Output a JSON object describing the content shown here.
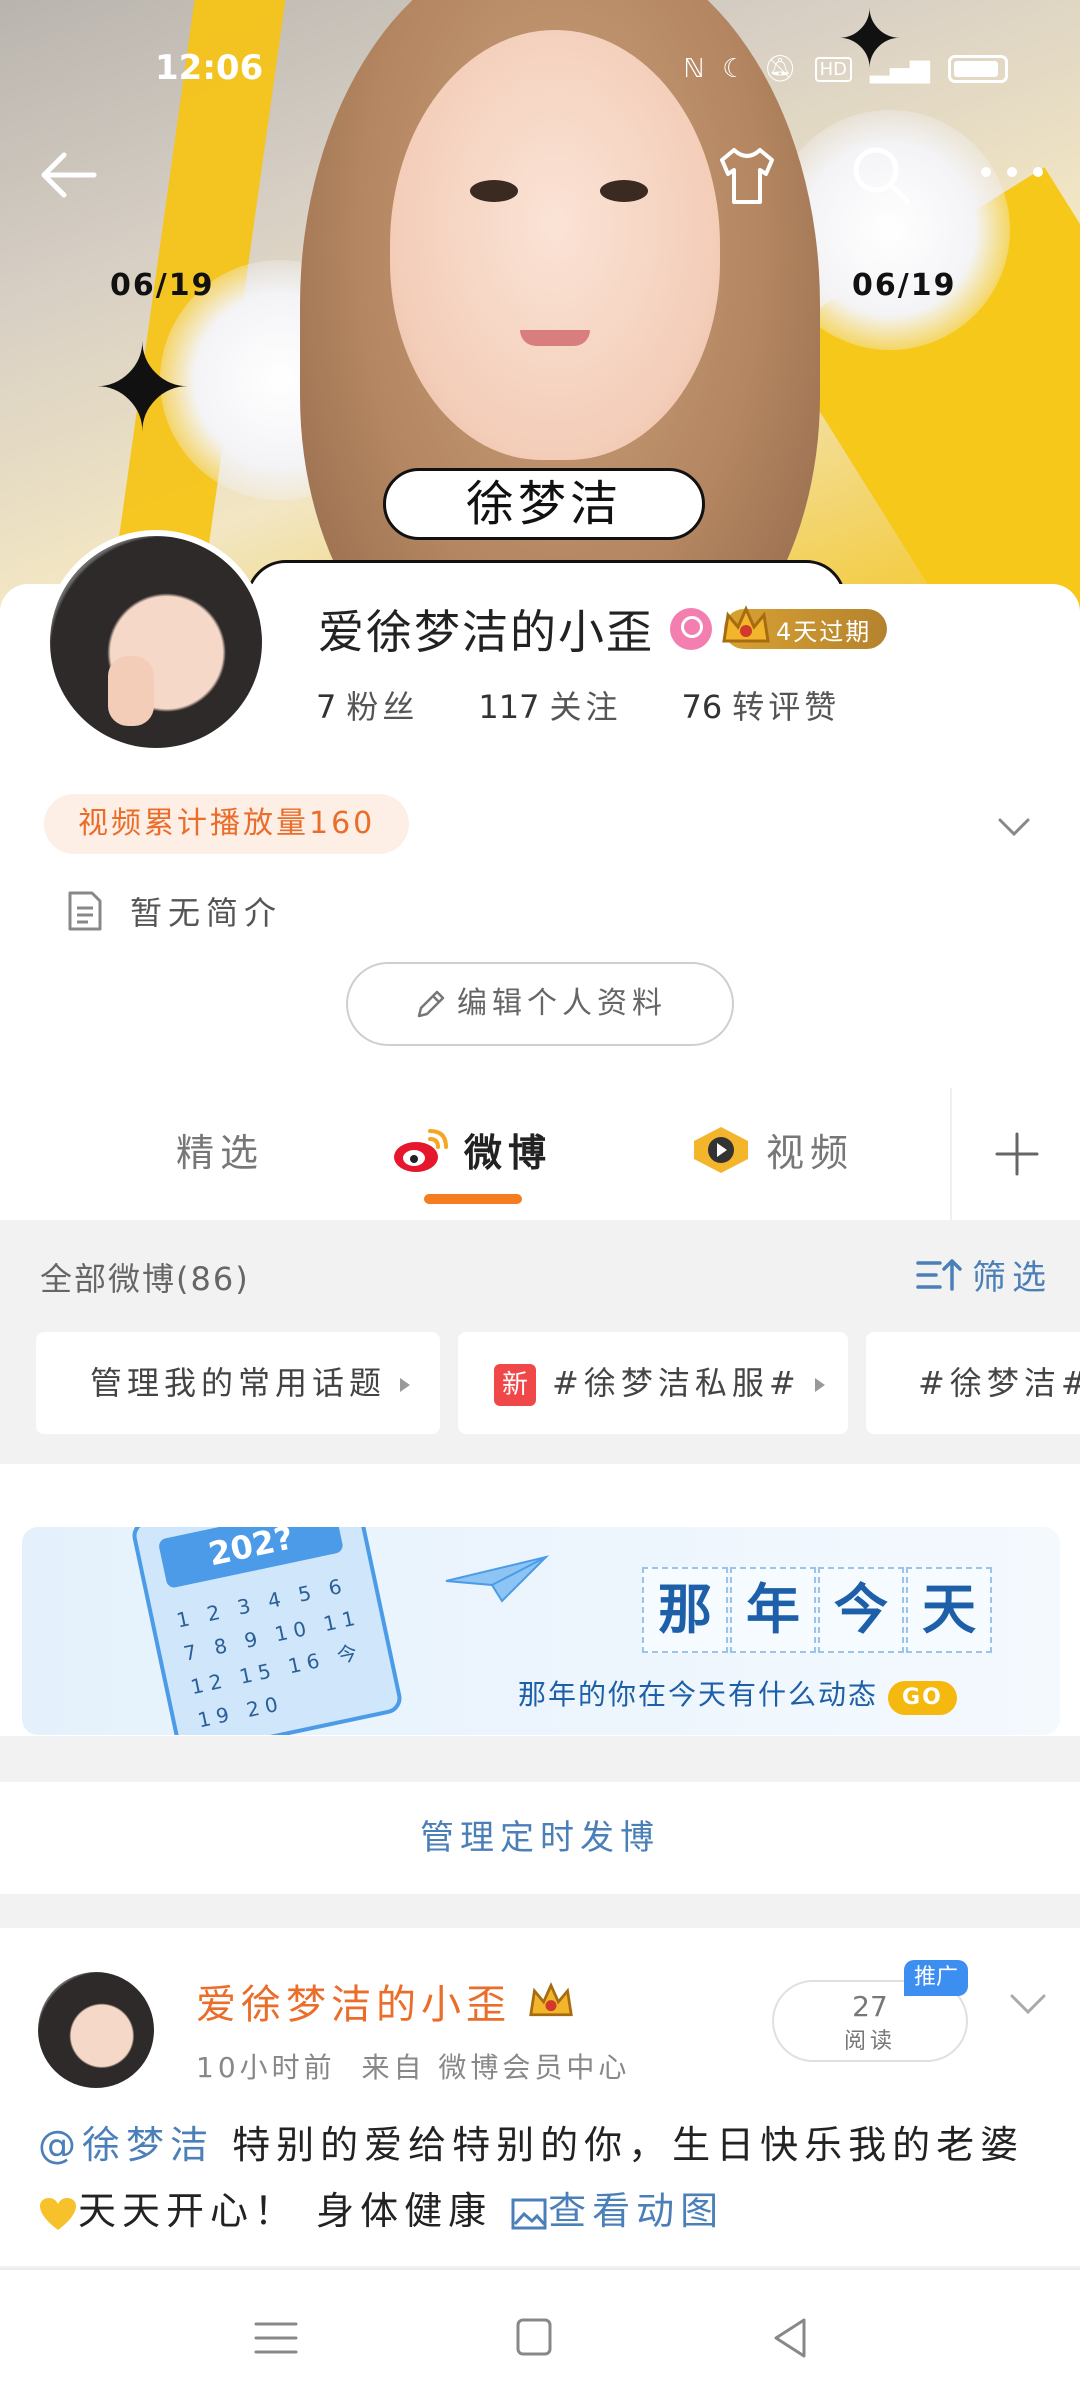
{
  "status_bar": {
    "time": "12:06"
  },
  "cover": {
    "date_left": "06/19",
    "date_right": "06/19",
    "name_banner": "徐梦洁"
  },
  "profile": {
    "username": "爱徐梦洁的小歪",
    "vip_badge": "4天过期",
    "stats": [
      {
        "value": "7",
        "label": "粉丝"
      },
      {
        "value": "117",
        "label": "关注"
      },
      {
        "value": "76",
        "label": "转评赞"
      }
    ],
    "video_plays": "视频累计播放量160",
    "bio": "暂无简介",
    "edit_label": "编辑个人资料"
  },
  "tabs": [
    {
      "label": "精选"
    },
    {
      "label": "微博"
    },
    {
      "label": "视频"
    }
  ],
  "feed_header": {
    "all_weibo": "全部微博(86)",
    "filter": "筛选"
  },
  "topic_chips": [
    {
      "label": "管理我的常用话题"
    },
    {
      "label": "#徐梦洁私服#",
      "tag": "新"
    },
    {
      "label": "#徐梦洁#"
    }
  ],
  "banner": {
    "calendar_year": "202?",
    "calendar_numbers": "1 2 3 4 5 6 7 8 9 10 11 12 15 16 今 19 20",
    "title_chars": [
      "那",
      "年",
      "今",
      "天"
    ],
    "subtitle": "那年的你在今天有什么动态",
    "go": "GO"
  },
  "manage_scheduled": "管理定时发博",
  "post": {
    "author": "爱徐梦洁的小歪",
    "time": "10小时前",
    "source": "来自 微博会员中心",
    "reads_count": "27",
    "reads_label": "阅读",
    "promo": "推广",
    "mention": "@徐梦洁",
    "text_1": " 特别的爱给特别的你，生日快乐我的老婆",
    "text_2": "天天开心！ 身体健康 ",
    "link": "查看动图"
  },
  "colors": {
    "accent_orange": "#ea6d2a",
    "link_blue": "#4b7fb8",
    "tab_underline": "#f57c1f"
  }
}
